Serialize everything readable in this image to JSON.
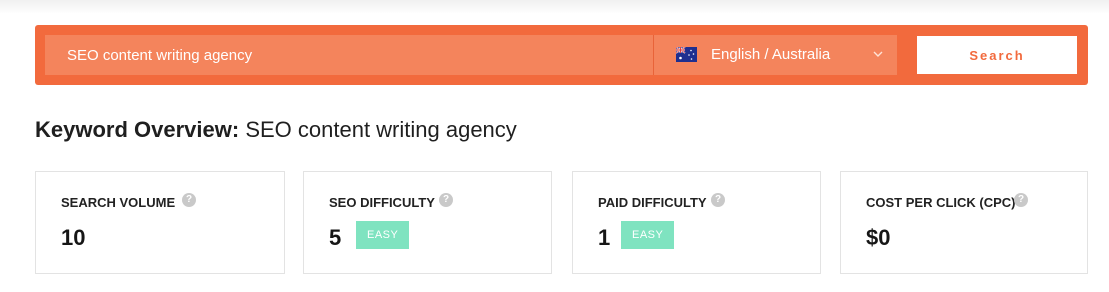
{
  "search": {
    "keyword_value": "SEO content writing agency",
    "keyword_placeholder": "",
    "language_label": "English / Australia",
    "flag_icon": "australia-flag-icon",
    "button_label": "Search",
    "colors": {
      "bar": "#f26a3d",
      "field": "#f4845c"
    }
  },
  "overview": {
    "title_label": "Keyword Overview:",
    "title_keyword": "SEO content writing agency"
  },
  "metrics": [
    {
      "label": "SEARCH VOLUME",
      "value": "10",
      "badge": null
    },
    {
      "label": "SEO DIFFICULTY",
      "value": "5",
      "badge": "EASY"
    },
    {
      "label": "PAID DIFFICULTY",
      "value": "1",
      "badge": "EASY"
    },
    {
      "label": "COST PER CLICK (CPC)",
      "value": "$0",
      "badge": null
    }
  ],
  "help_icon_glyph": "?",
  "badge_color": "#7fe3c0"
}
